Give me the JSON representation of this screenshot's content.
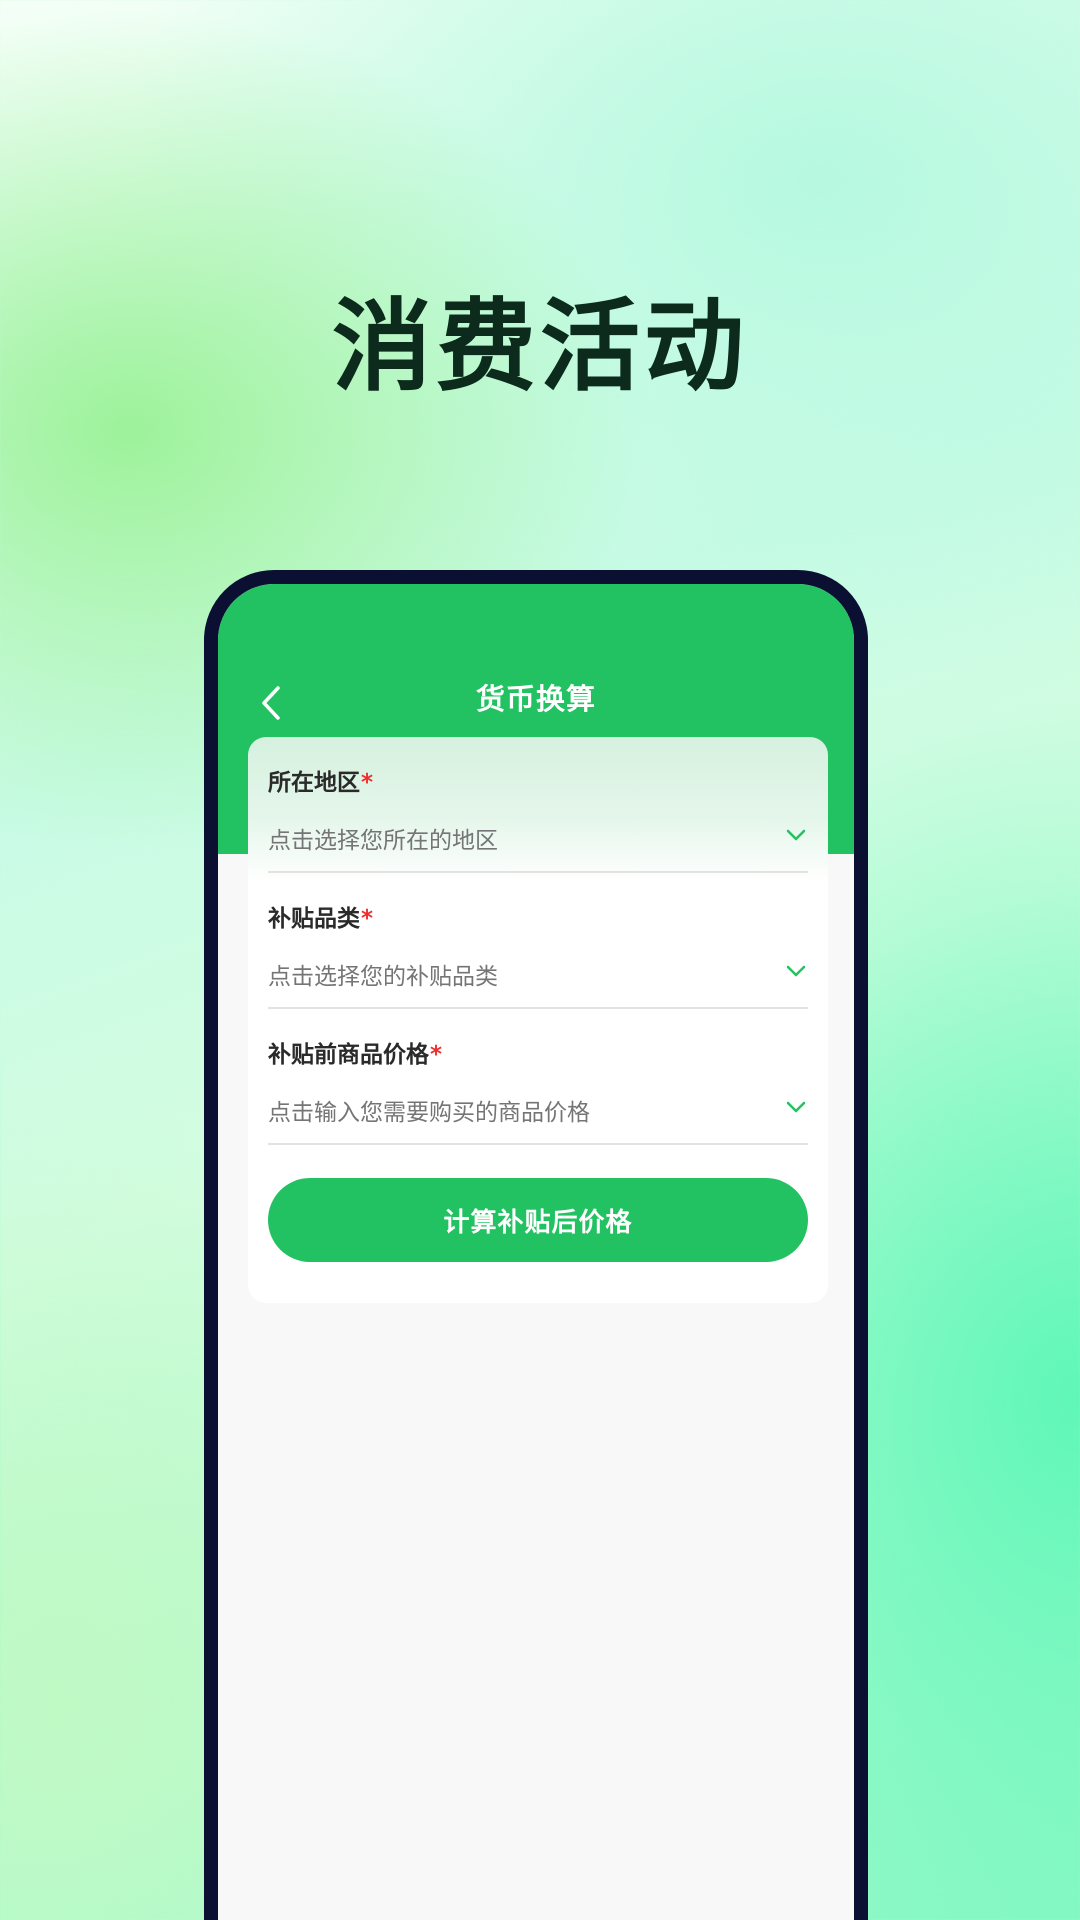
{
  "promo": {
    "headline": "消费活动"
  },
  "app": {
    "title": "货币换算",
    "back_icon": "chevron-left-icon"
  },
  "form": {
    "fields": [
      {
        "label": "所在地区",
        "required_mark": "*",
        "placeholder": "点击选择您所在的地区",
        "icon": "chevron-down-icon"
      },
      {
        "label": "补贴品类",
        "required_mark": "*",
        "placeholder": "点击选择您的补贴品类",
        "icon": "chevron-down-icon"
      },
      {
        "label": "补贴前商品价格",
        "required_mark": "*",
        "placeholder": "点击输入您需要购买的商品价格",
        "icon": "chevron-down-icon"
      }
    ],
    "submit_label": "计算补贴后价格"
  },
  "colors": {
    "brand_green": "#22c262",
    "headline": "#0c2b1d",
    "phone_frame": "#0b1033",
    "required": "#ee2e2e"
  }
}
